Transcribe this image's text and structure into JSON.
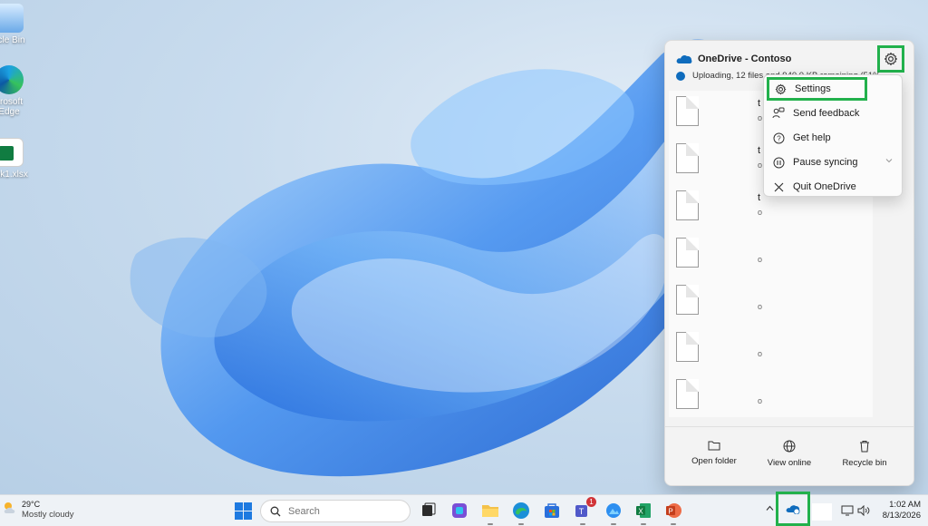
{
  "desktop": {
    "icons": [
      {
        "label": "ycle Bin",
        "icon": "recycle-bin-icon"
      },
      {
        "label": "crosoft\nEdge",
        "icon": "edge-icon"
      },
      {
        "label": "ook1.xlsx",
        "icon": "excel-file-icon"
      }
    ]
  },
  "onedrive": {
    "title": "OneDrive - Contoso",
    "status": "Uploading, 12 files and 940.0 KB remaining (51%)",
    "files": [
      {
        "name": "t",
        "meta": "o"
      },
      {
        "name": "t",
        "meta": "o"
      },
      {
        "name": "t",
        "meta": "o"
      },
      {
        "name": "",
        "meta": "o"
      },
      {
        "name": "",
        "meta": "o"
      },
      {
        "name": "",
        "meta": "o"
      },
      {
        "name": "",
        "meta": "o"
      }
    ],
    "footer": {
      "open_folder": "Open folder",
      "view_online": "View online",
      "recycle_bin": "Recycle bin"
    }
  },
  "menu": {
    "items": [
      {
        "label": "Settings",
        "icon": "gear-icon"
      },
      {
        "label": "Send feedback",
        "icon": "feedback-icon"
      },
      {
        "label": "Get help",
        "icon": "help-icon"
      },
      {
        "label": "Pause syncing",
        "icon": "pause-icon"
      },
      {
        "label": "Quit OneDrive",
        "icon": "close-icon"
      }
    ]
  },
  "taskbar": {
    "weather_temp": "29°C",
    "weather_desc": "Mostly cloudy",
    "search_placeholder": "Search",
    "teams_badge": "1",
    "time": "1:02 AM",
    "date": "8/13/2026"
  },
  "colors": {
    "highlight": "#22b14c",
    "onedrive_blue": "#0f6cbd"
  }
}
